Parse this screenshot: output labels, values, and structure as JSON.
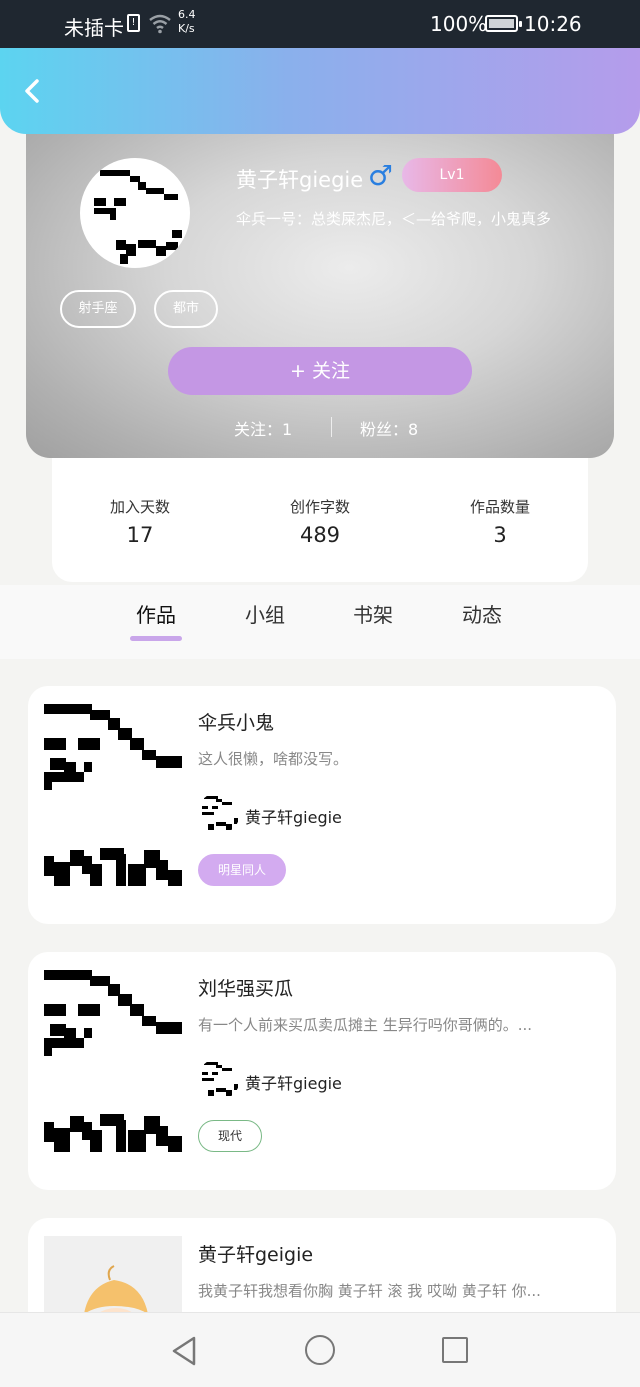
{
  "status_bar": {
    "carrier": "未插卡",
    "sim_icon": "sim-alert-icon",
    "net_speed_value": "6.4",
    "net_speed_unit": "K/s",
    "battery_percent": "100%",
    "time": "10:26"
  },
  "header": {
    "back_icon": "chevron-left-icon"
  },
  "profile": {
    "name": "黄子轩giegie",
    "gender_symbol": "♂",
    "level": "Lv1",
    "bio": "伞兵一号：总类屎杰尼，＜—给爷爬，小鬼真多",
    "tags": [
      "射手座",
      "都市"
    ],
    "follow_label": "+  关注",
    "following_text": "关注：1",
    "followers_text": "粉丝：8"
  },
  "stats": [
    {
      "label": "加入天数",
      "value": "17"
    },
    {
      "label": "创作字数",
      "value": "489"
    },
    {
      "label": "作品数量",
      "value": "3"
    }
  ],
  "tabs": [
    "作品",
    "小组",
    "书架",
    "动态"
  ],
  "works": [
    {
      "title": "伞兵小鬼",
      "desc": "这人很懒，啥都没写。",
      "author": "黄子轩giegie",
      "chip": "明星同人"
    },
    {
      "title": "刘华强买瓜",
      "desc": "有一个人前来买瓜卖瓜摊主 生异行吗你哥俩的。...",
      "author": "黄子轩giegie",
      "chip": "现代"
    },
    {
      "title": "黄子轩geigie",
      "desc": "我黄子轩我想看你胸 黄子轩 滚 我 哎呦 黄子轩 你...",
      "author": "",
      "chip": ""
    }
  ],
  "colors": {
    "accent_purple": "#c497e4",
    "gradient_start": "#5cd4f0",
    "gradient_end": "#b59ceb",
    "level_badge": "#f48a96",
    "chip_outline_green": "#7ab986"
  }
}
